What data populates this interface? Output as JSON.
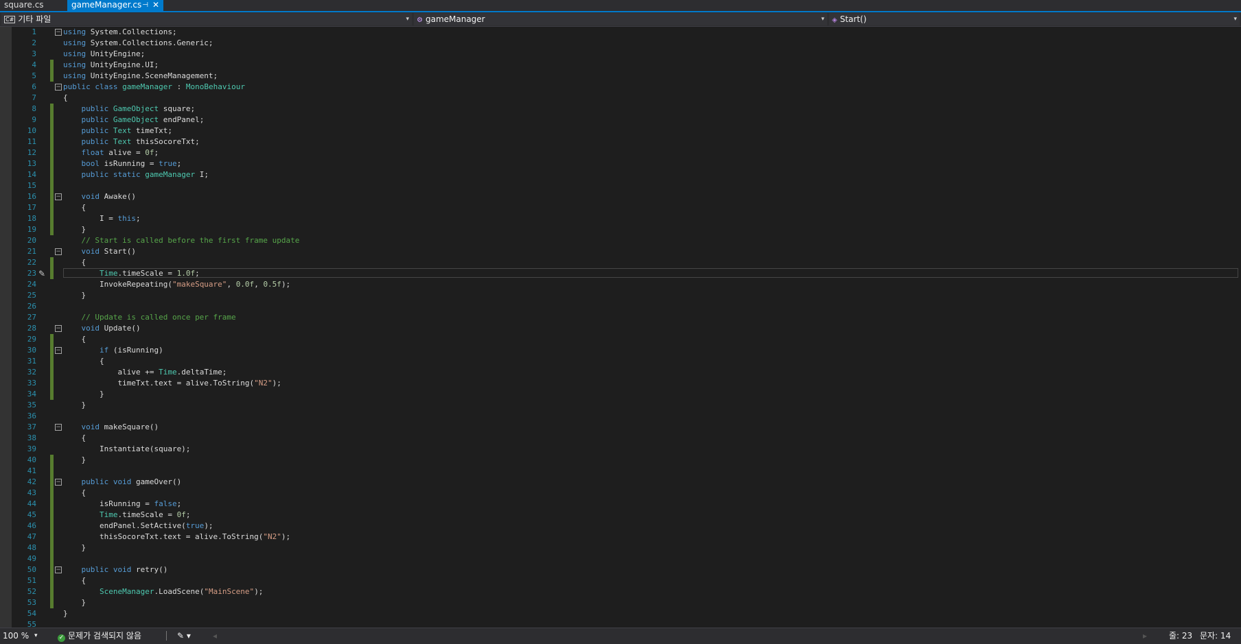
{
  "tabs": [
    {
      "label": "square.cs",
      "active": false
    },
    {
      "label": "gameManager.cs",
      "active": true,
      "pin": "⊣",
      "close": "✕"
    }
  ],
  "nav": {
    "project": "기타 파일",
    "project_icon": "C#",
    "type": "gameManager",
    "member": "Start()"
  },
  "editor": {
    "current_line": 23,
    "lines": [
      {
        "n": "1",
        "code": "<span class=\"kw\">using</span> System.Collections;",
        "fold": "minus",
        "chg": false
      },
      {
        "n": "2",
        "code": "<span class=\"kw\">using</span> System.Collections.Generic;",
        "fold": "",
        "chg": false
      },
      {
        "n": "3",
        "code": "<span class=\"kw\">using</span> UnityEngine;",
        "fold": "",
        "chg": false
      },
      {
        "n": "4",
        "code": "<span class=\"kw\">using</span> UnityEngine.UI;",
        "fold": "",
        "chg": true
      },
      {
        "n": "5",
        "code": "<span class=\"kw\">using</span> UnityEngine.SceneManagement;",
        "fold": "",
        "chg": true
      },
      {
        "n": "6",
        "code": "<span class=\"kw\">public</span> <span class=\"kw\">class</span> <span class=\"ty\">gameManager</span> : <span class=\"ty\">MonoBehaviour</span>",
        "fold": "minus",
        "chg": false
      },
      {
        "n": "7",
        "code": "{",
        "fold": "",
        "chg": false
      },
      {
        "n": "8",
        "code": "    <span class=\"kw\">public</span> <span class=\"ty\">GameObject</span> square;",
        "fold": "",
        "chg": true
      },
      {
        "n": "9",
        "code": "    <span class=\"kw\">public</span> <span class=\"ty\">GameObject</span> endPanel;",
        "fold": "",
        "chg": true
      },
      {
        "n": "10",
        "code": "    <span class=\"kw\">public</span> <span class=\"ty\">Text</span> timeTxt;",
        "fold": "",
        "chg": true
      },
      {
        "n": "11",
        "code": "    <span class=\"kw\">public</span> <span class=\"ty\">Text</span> thisSocoreTxt;",
        "fold": "",
        "chg": true
      },
      {
        "n": "12",
        "code": "    <span class=\"kw\">float</span> alive = <span class=\"nm\">0f</span>;",
        "fold": "",
        "chg": true
      },
      {
        "n": "13",
        "code": "    <span class=\"kw\">bool</span> isRunning = <span class=\"kw\">true</span>;",
        "fold": "",
        "chg": true
      },
      {
        "n": "14",
        "code": "    <span class=\"kw\">public</span> <span class=\"kw\">static</span> <span class=\"ty\">gameManager</span> I;",
        "fold": "",
        "chg": true
      },
      {
        "n": "15",
        "code": "",
        "fold": "",
        "chg": true
      },
      {
        "n": "16",
        "code": "    <span class=\"kw\">void</span> Awake()",
        "fold": "minus",
        "chg": true
      },
      {
        "n": "17",
        "code": "    {",
        "fold": "",
        "chg": true
      },
      {
        "n": "18",
        "code": "        I = <span class=\"kw\">this</span>;",
        "fold": "",
        "chg": true
      },
      {
        "n": "19",
        "code": "    }",
        "fold": "",
        "chg": true
      },
      {
        "n": "20",
        "code": "    <span class=\"cm\">// Start is called before the first frame update</span>",
        "fold": "",
        "chg": false
      },
      {
        "n": "21",
        "code": "    <span class=\"kw\">void</span> Start()",
        "fold": "minus",
        "chg": false
      },
      {
        "n": "22",
        "code": "    {",
        "fold": "",
        "chg": true
      },
      {
        "n": "23",
        "code": "        <span class=\"ty\">Time</span>.timeScale = <span class=\"nm\">1.0f</span>;",
        "fold": "",
        "chg": true
      },
      {
        "n": "24",
        "code": "        InvokeRepeating(<span class=\"st\">\"makeSquare\"</span>, <span class=\"nm\">0.0f</span>, <span class=\"nm\">0.5f</span>);",
        "fold": "",
        "chg": false
      },
      {
        "n": "25",
        "code": "    }",
        "fold": "",
        "chg": false
      },
      {
        "n": "26",
        "code": "",
        "fold": "",
        "chg": false
      },
      {
        "n": "27",
        "code": "    <span class=\"cm\">// Update is called once per frame</span>",
        "fold": "",
        "chg": false
      },
      {
        "n": "28",
        "code": "    <span class=\"kw\">void</span> Update()",
        "fold": "minus",
        "chg": false
      },
      {
        "n": "29",
        "code": "    {",
        "fold": "",
        "chg": true
      },
      {
        "n": "30",
        "code": "        <span class=\"kw\">if</span> (isRunning)",
        "fold": "minus",
        "chg": true
      },
      {
        "n": "31",
        "code": "        {",
        "fold": "",
        "chg": true
      },
      {
        "n": "32",
        "code": "            alive += <span class=\"ty\">Time</span>.deltaTime;",
        "fold": "",
        "chg": true
      },
      {
        "n": "33",
        "code": "            timeTxt.text = alive.ToString(<span class=\"st\">\"N2\"</span>);",
        "fold": "",
        "chg": true
      },
      {
        "n": "34",
        "code": "        }",
        "fold": "",
        "chg": true
      },
      {
        "n": "35",
        "code": "    }",
        "fold": "",
        "chg": false
      },
      {
        "n": "36",
        "code": "",
        "fold": "",
        "chg": false
      },
      {
        "n": "37",
        "code": "    <span class=\"kw\">void</span> makeSquare()",
        "fold": "minus",
        "chg": false
      },
      {
        "n": "38",
        "code": "    {",
        "fold": "",
        "chg": false
      },
      {
        "n": "39",
        "code": "        Instantiate(square);",
        "fold": "",
        "chg": false
      },
      {
        "n": "40",
        "code": "    }",
        "fold": "",
        "chg": true
      },
      {
        "n": "41",
        "code": "",
        "fold": "",
        "chg": true
      },
      {
        "n": "42",
        "code": "    <span class=\"kw\">public</span> <span class=\"kw\">void</span> gameOver()",
        "fold": "minus",
        "chg": true
      },
      {
        "n": "43",
        "code": "    {",
        "fold": "",
        "chg": true
      },
      {
        "n": "44",
        "code": "        isRunning = <span class=\"kw\">false</span>;",
        "fold": "",
        "chg": true
      },
      {
        "n": "45",
        "code": "        <span class=\"ty\">Time</span>.timeScale = <span class=\"nm\">0f</span>;",
        "fold": "",
        "chg": true
      },
      {
        "n": "46",
        "code": "        endPanel.SetActive(<span class=\"kw\">true</span>);",
        "fold": "",
        "chg": true
      },
      {
        "n": "47",
        "code": "        thisSocoreTxt.text = alive.ToString(<span class=\"st\">\"N2\"</span>);",
        "fold": "",
        "chg": true
      },
      {
        "n": "48",
        "code": "    }",
        "fold": "",
        "chg": true
      },
      {
        "n": "49",
        "code": "",
        "fold": "",
        "chg": true
      },
      {
        "n": "50",
        "code": "    <span class=\"kw\">public</span> <span class=\"kw\">void</span> retry()",
        "fold": "minus",
        "chg": true
      },
      {
        "n": "51",
        "code": "    {",
        "fold": "",
        "chg": true
      },
      {
        "n": "52",
        "code": "        <span class=\"ty\">SceneManager</span>.LoadScene(<span class=\"st\">\"MainScene\"</span>);",
        "fold": "",
        "chg": true
      },
      {
        "n": "53",
        "code": "    }",
        "fold": "",
        "chg": true
      },
      {
        "n": "54",
        "code": "}",
        "fold": "",
        "chg": false
      },
      {
        "n": "55",
        "code": "",
        "fold": "",
        "chg": false
      }
    ]
  },
  "status": {
    "zoom": "100 %",
    "issues": "문제가 검색되지 않음",
    "line": "줄: 23",
    "col": "문자: 14"
  },
  "colors": {
    "accent": "#007acc",
    "changed": "#577c2f",
    "keyword": "#569cd6",
    "type": "#4ec9b0",
    "string": "#d69d85",
    "comment": "#57a64a"
  }
}
